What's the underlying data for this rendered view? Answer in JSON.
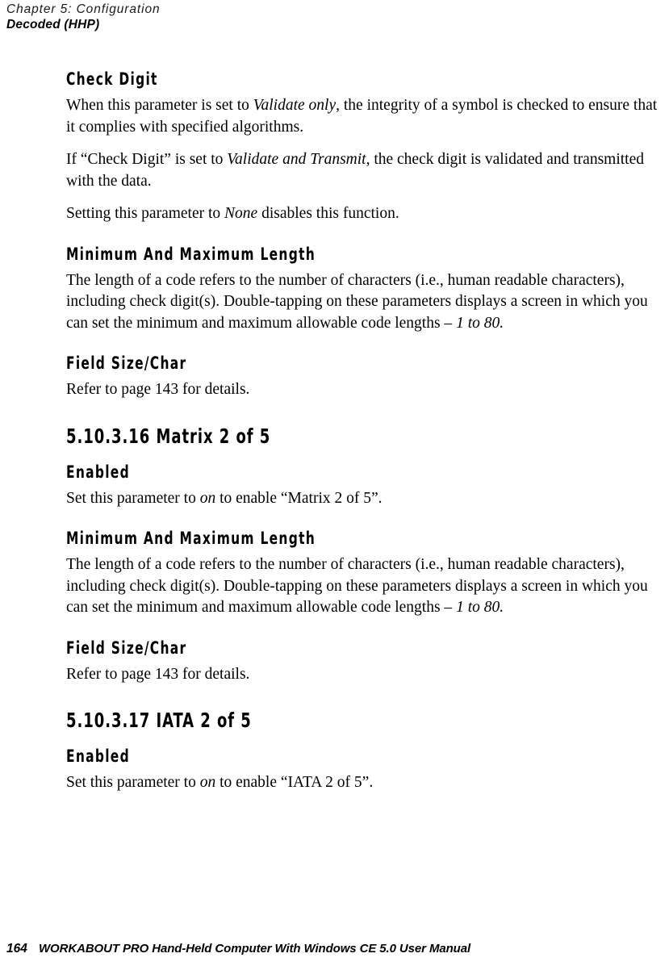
{
  "header": {
    "chapter_line": "Chapter 5: Configuration",
    "section_line": "Decoded (HHP)"
  },
  "content": {
    "blocks": [
      {
        "id": "check-digit",
        "heading": "Check Digit",
        "paragraphs": [
          {
            "id": "check-digit-p1",
            "runs": [
              {
                "text": "When this parameter is set to ",
                "style": "normal"
              },
              {
                "text": "Validate only",
                "style": "italic"
              },
              {
                "text": ", the integrity of a symbol is checked to ensure that it complies with specified algorithms.",
                "style": "normal"
              }
            ]
          },
          {
            "id": "check-digit-p2",
            "runs": [
              {
                "text": "If “Check Digit” is set to ",
                "style": "normal"
              },
              {
                "text": "Validate and Transmit",
                "style": "italic"
              },
              {
                "text": ", the check digit is validated and transmitted with the data.",
                "style": "normal"
              }
            ]
          },
          {
            "id": "check-digit-p3",
            "runs": [
              {
                "text": "Setting this parameter to ",
                "style": "normal"
              },
              {
                "text": "None",
                "style": "italic"
              },
              {
                "text": " disables this function.",
                "style": "normal"
              }
            ]
          }
        ]
      },
      {
        "id": "min-max-length-1",
        "heading": "Minimum And Maximum Length",
        "paragraphs": [
          {
            "id": "min-max-length-1-p1",
            "runs": [
              {
                "text": "The length of a code refers to the number of characters (i.e., human readable characters), including check digit(s). Double-tapping on these parameters displays a screen in which you can set the minimum and maximum allowable code lengths – ",
                "style": "normal"
              },
              {
                "text": "1 to 80.",
                "style": "italic"
              }
            ]
          }
        ]
      },
      {
        "id": "field-size-char-1",
        "heading": "Field Size/Char",
        "paragraphs": [
          {
            "id": "field-size-char-1-p1",
            "runs": [
              {
                "text": "Refer to page 143 for details.",
                "style": "normal"
              }
            ]
          }
        ]
      },
      {
        "id": "matrix-2-of-5",
        "section_heading": "5.10.3.16  Matrix 2 of 5"
      },
      {
        "id": "matrix-enabled",
        "heading": "Enabled",
        "paragraphs": [
          {
            "id": "matrix-enabled-p1",
            "runs": [
              {
                "text": "Set this parameter to ",
                "style": "normal"
              },
              {
                "text": "on",
                "style": "italic"
              },
              {
                "text": " to enable “Matrix 2 of 5”.",
                "style": "normal"
              }
            ]
          }
        ]
      },
      {
        "id": "min-max-length-2",
        "heading": "Minimum And Maximum Length",
        "paragraphs": [
          {
            "id": "min-max-length-2-p1",
            "runs": [
              {
                "text": "The length of a code refers to the number of characters (i.e., human readable characters), including check digit(s). Double-tapping on these parameters displays a screen in which you can set the minimum and maximum allowable code lengths – ",
                "style": "normal"
              },
              {
                "text": "1 to 80.",
                "style": "italic"
              }
            ]
          }
        ]
      },
      {
        "id": "field-size-char-2",
        "heading": "Field Size/Char",
        "paragraphs": [
          {
            "id": "field-size-char-2-p1",
            "runs": [
              {
                "text": "Refer to page 143 for details.",
                "style": "normal"
              }
            ]
          }
        ]
      },
      {
        "id": "iata-2-of-5",
        "section_heading": "5.10.3.17  IATA 2 of 5"
      },
      {
        "id": "iata-enabled",
        "heading": "Enabled",
        "paragraphs": [
          {
            "id": "iata-enabled-p1",
            "runs": [
              {
                "text": "Set this parameter to ",
                "style": "normal"
              },
              {
                "text": "on",
                "style": "italic"
              },
              {
                "text": " to enable “IATA 2 of 5”.",
                "style": "normal"
              }
            ]
          }
        ]
      }
    ]
  },
  "footer": {
    "page_number": "164",
    "text": "WORKABOUT PRO Hand-Held Computer With Windows CE 5.0 User Manual"
  }
}
